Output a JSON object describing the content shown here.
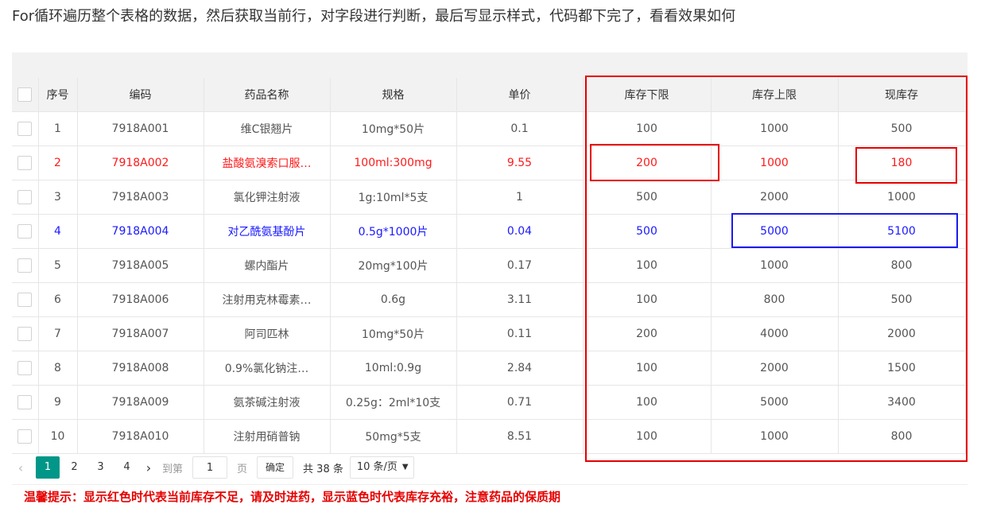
{
  "headline": "For循环遍历整个表格的数据，然后获取当前行，对字段进行判断，最后写显示样式，代码都下完了，看看效果如何",
  "table": {
    "columns": [
      "序号",
      "编码",
      "药品名称",
      "规格",
      "单价",
      "库存下限",
      "库存上限",
      "现库存"
    ],
    "rows": [
      {
        "no": "1",
        "code": "7918A001",
        "name": "维C银翘片",
        "spec": "10mg*50片",
        "price": "0.1",
        "min": "100",
        "max": "1000",
        "stock": "500",
        "status": "normal"
      },
      {
        "no": "2",
        "code": "7918A002",
        "name": "盐酸氨溴索口服…",
        "spec": "100ml:300mg",
        "price": "9.55",
        "min": "200",
        "max": "1000",
        "stock": "180",
        "status": "low"
      },
      {
        "no": "3",
        "code": "7918A003",
        "name": "氯化钾注射液",
        "spec": "1g:10ml*5支",
        "price": "1",
        "min": "500",
        "max": "2000",
        "stock": "1000",
        "status": "normal"
      },
      {
        "no": "4",
        "code": "7918A004",
        "name": "对乙酰氨基酚片",
        "spec": "0.5g*1000片",
        "price": "0.04",
        "min": "500",
        "max": "5000",
        "stock": "5100",
        "status": "high"
      },
      {
        "no": "5",
        "code": "7918A005",
        "name": "螺内酯片",
        "spec": "20mg*100片",
        "price": "0.17",
        "min": "100",
        "max": "1000",
        "stock": "800",
        "status": "normal"
      },
      {
        "no": "6",
        "code": "7918A006",
        "name": "注射用克林霉素…",
        "spec": "0.6g",
        "price": "3.11",
        "min": "100",
        "max": "800",
        "stock": "500",
        "status": "normal"
      },
      {
        "no": "7",
        "code": "7918A007",
        "name": "阿司匹林",
        "spec": "10mg*50片",
        "price": "0.11",
        "min": "200",
        "max": "4000",
        "stock": "2000",
        "status": "normal"
      },
      {
        "no": "8",
        "code": "7918A008",
        "name": "0.9%氯化钠注…",
        "spec": "10ml:0.9g",
        "price": "2.84",
        "min": "100",
        "max": "2000",
        "stock": "1500",
        "status": "normal"
      },
      {
        "no": "9",
        "code": "7918A009",
        "name": "氨茶碱注射液",
        "spec": "0.25g：2ml*10支",
        "price": "0.71",
        "min": "100",
        "max": "5000",
        "stock": "3400",
        "status": "normal"
      },
      {
        "no": "10",
        "code": "7918A010",
        "name": "注射用硝普钠",
        "spec": "50mg*5支",
        "price": "8.51",
        "min": "100",
        "max": "1000",
        "stock": "800",
        "status": "normal"
      }
    ]
  },
  "pagination": {
    "pages": [
      "1",
      "2",
      "3",
      "4"
    ],
    "active_page": "1",
    "goto_prefix": "到第",
    "goto_value": "1",
    "goto_suffix": "页",
    "confirm_label": "确定",
    "total_label": "共 38 条",
    "page_size_label": "10 条/页"
  },
  "tip": "温馨提示：显示红色时代表当前库存不足，请及时进药，显示蓝色时代表库存充裕，注意药品的保质期",
  "colors": {
    "low": "#ff1a1a",
    "high": "#1a1aff",
    "accent": "#009688",
    "annotation_red": "#e60000",
    "annotation_blue": "#1a1aee"
  }
}
